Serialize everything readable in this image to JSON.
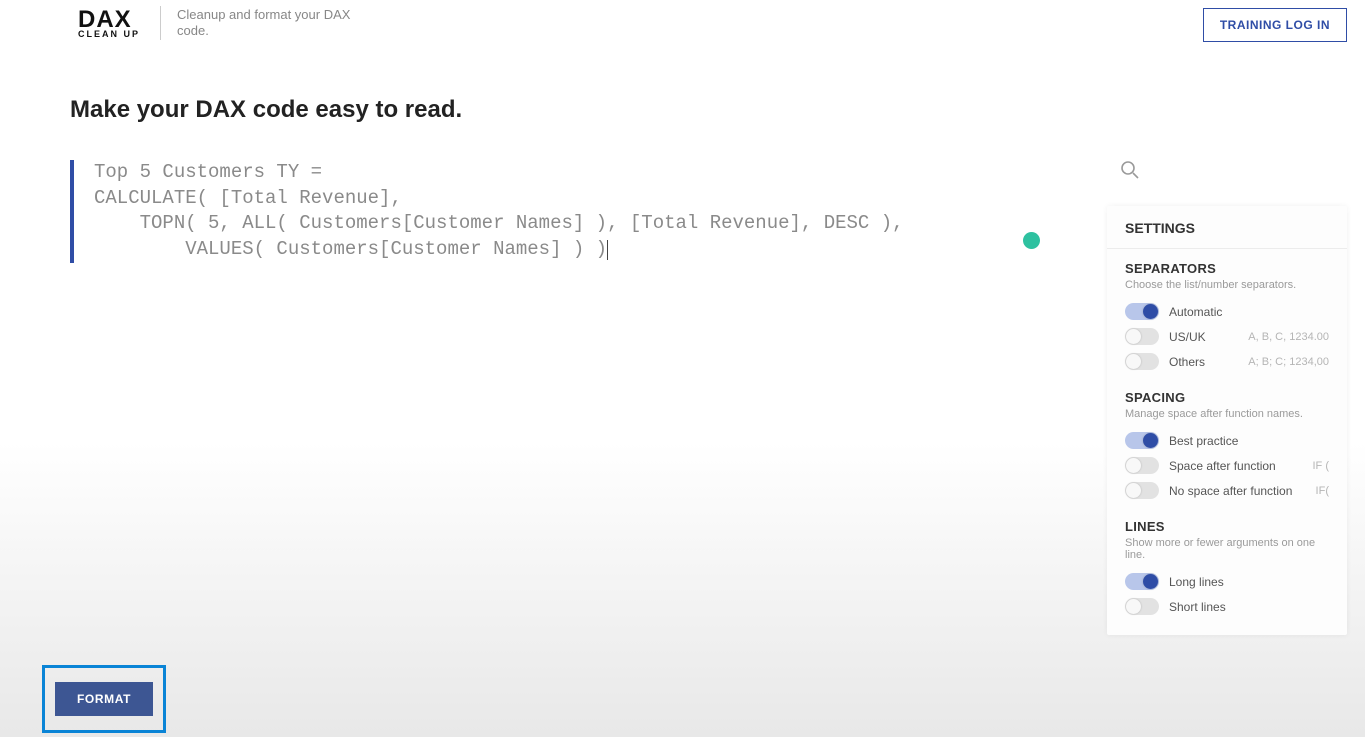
{
  "header": {
    "logo_main": "DAX",
    "logo_sub": "CLEAN UP",
    "tagline": "Cleanup and format your DAX code.",
    "login_label": "TRAINING LOG IN"
  },
  "main": {
    "heading": "Make your DAX code easy to read.",
    "code": "Top 5 Customers TY =\nCALCULATE( [Total Revenue],\n    TOPN( 5, ALL( Customers[Customer Names] ), [Total Revenue], DESC ),\n        VALUES( Customers[Customer Names] ) )"
  },
  "settings": {
    "title": "SETTINGS",
    "separators": {
      "title": "SEPARATORS",
      "desc": "Choose the list/number separators.",
      "options": [
        {
          "label": "Automatic",
          "hint": "",
          "on": true
        },
        {
          "label": "US/UK",
          "hint": "A, B, C, 1234.00",
          "on": false
        },
        {
          "label": "Others",
          "hint": "A; B; C; 1234,00",
          "on": false
        }
      ]
    },
    "spacing": {
      "title": "SPACING",
      "desc": "Manage space after function names.",
      "options": [
        {
          "label": "Best practice",
          "hint": "",
          "on": true
        },
        {
          "label": "Space after function",
          "hint": "IF (",
          "on": false
        },
        {
          "label": "No space after function",
          "hint": "IF(",
          "on": false
        }
      ]
    },
    "lines": {
      "title": "LINES",
      "desc": "Show more or fewer arguments on one line.",
      "options": [
        {
          "label": "Long lines",
          "hint": "",
          "on": true
        },
        {
          "label": "Short lines",
          "hint": "",
          "on": false
        }
      ]
    }
  },
  "footer": {
    "format_label": "FORMAT"
  }
}
